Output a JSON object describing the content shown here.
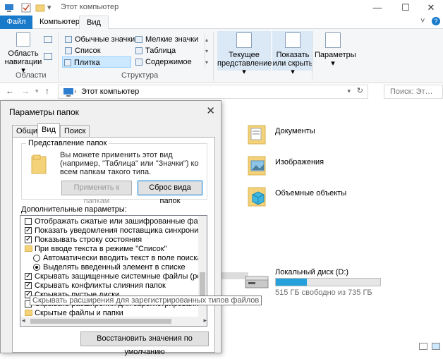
{
  "window": {
    "title": "Этот компьютер",
    "minimize": "—",
    "maximize": "☐",
    "close": "✕"
  },
  "ribbon": {
    "tabs": {
      "file": "Файл",
      "computer": "Компьютер",
      "view": "Вид"
    },
    "nav_pane": {
      "label_line1": "Область",
      "label_line2": "навигации ▾",
      "group": "Области"
    },
    "layout": {
      "items": [
        "Обычные значки",
        "Мелкие значки",
        "Список",
        "Таблица",
        "Плитка",
        "Содержимое"
      ],
      "selected": "Плитка",
      "group": "Структура"
    },
    "current_view": {
      "line1": "Текущее",
      "line2": "представление ▾"
    },
    "show_hide": {
      "line1": "Показать",
      "line2": "или скрыть ▾"
    },
    "options": {
      "line1": "Параметры",
      "line2": "▾"
    },
    "expand": "˅",
    "help": "?"
  },
  "address": {
    "path": "Этот компьютер",
    "search_placeholder": "Поиск: Эт…"
  },
  "folders": [
    {
      "name": "Документы",
      "icon": "documents-folder-icon"
    },
    {
      "name": "Изображения",
      "icon": "pictures-folder-icon"
    },
    {
      "name": "Объемные объекты",
      "icon": "3d-objects-folder-icon"
    }
  ],
  "drive": {
    "name": "Локальный диск (D:)",
    "free": "515 ГБ свободно из 735 ГБ",
    "used_fraction": 0.3
  },
  "dialog": {
    "title": "Параметры папок",
    "close": "✕",
    "tabs": [
      "Общие",
      "Вид",
      "Поиск"
    ],
    "active_tab": "Вид",
    "folder_views": {
      "legend": "Представление папок",
      "text": "Вы можете применить этот вид (например, \"Таблица\" или \"Значки\") ко всем папкам такого типа.",
      "apply_button": "Применить к папкам",
      "reset_button": "Сброс вида папок"
    },
    "advanced_label": "Дополнительные параметры:",
    "advanced_items": [
      {
        "type": "checkbox",
        "checked": false,
        "indent": 1,
        "text": "Отображать сжатые или зашифрованные файлы NTI"
      },
      {
        "type": "checkbox",
        "checked": true,
        "indent": 1,
        "text": "Показать уведомления поставщика синхронизации"
      },
      {
        "type": "checkbox",
        "checked": true,
        "indent": 1,
        "text": "Показывать строку состояния"
      },
      {
        "type": "folder",
        "indent": 1,
        "text": "При вводе текста в режиме \"Список\""
      },
      {
        "type": "radio",
        "checked": false,
        "indent": 2,
        "text": "Автоматически вводить текст в поле поиска"
      },
      {
        "type": "radio",
        "checked": true,
        "indent": 2,
        "text": "Выделять введенный элемент в списке"
      },
      {
        "type": "checkbox",
        "checked": true,
        "indent": 1,
        "text": "Скрывать защищенные системные файлы (рекомен"
      },
      {
        "type": "checkbox",
        "checked": true,
        "indent": 1,
        "text": "Скрывать конфликты слияния папок"
      },
      {
        "type": "checkbox",
        "checked": true,
        "indent": 1,
        "text": "Скрывать пустые диски"
      },
      {
        "type": "checkbox",
        "checked": false,
        "indent": 1,
        "text": "Скрывать расширения для зарегистрированных типов файлов"
      },
      {
        "type": "folder",
        "indent": 1,
        "text": "Скрытые файлы и папки"
      }
    ],
    "tooltip": "Скрывать расширения для зарегистрированных типов файлов",
    "restore_button": "Восстановить значения по умолчанию"
  },
  "colors": {
    "accent": "#1979ca",
    "drive_bar": "#26a0da"
  }
}
